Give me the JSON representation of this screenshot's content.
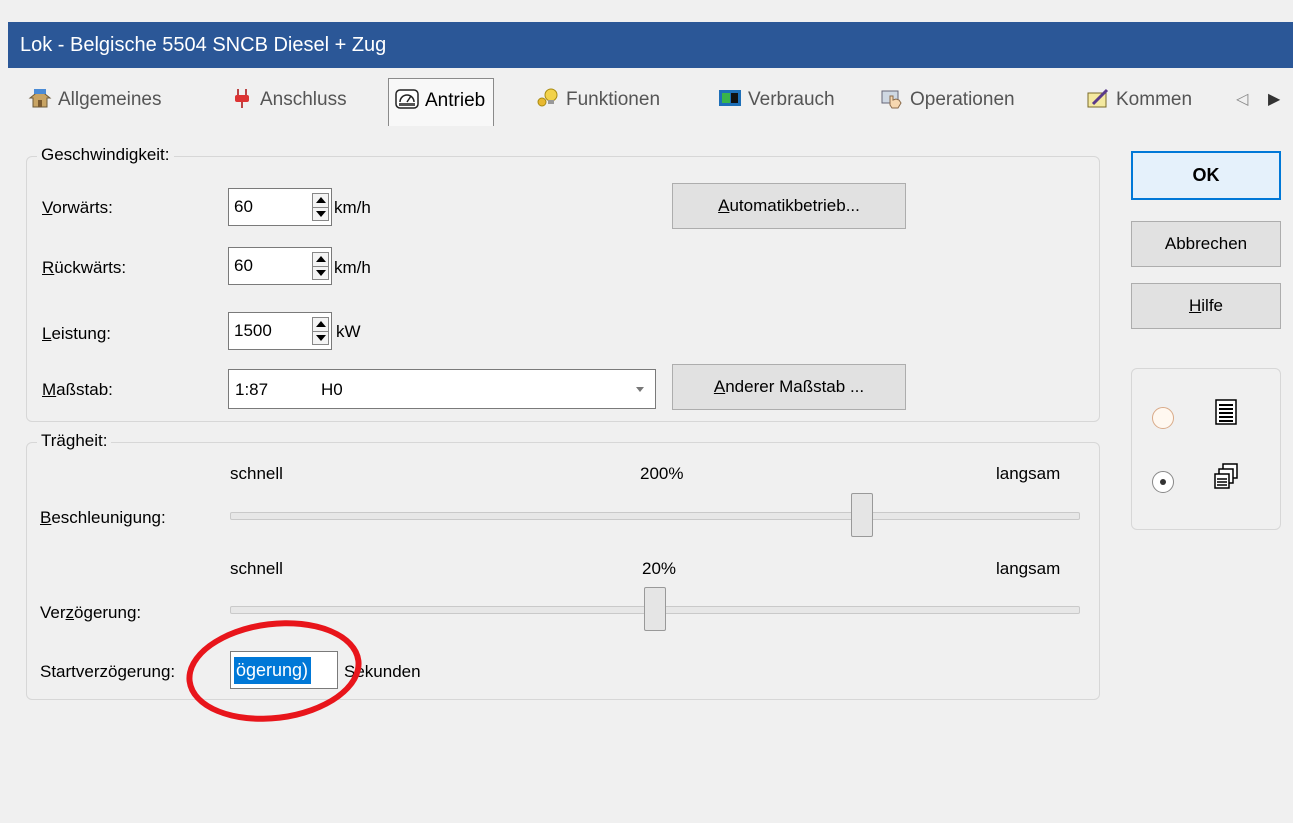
{
  "window": {
    "title": "Lok - Belgische 5504 SNCB Diesel + Zug"
  },
  "tabs": [
    {
      "label": "Allgemeines",
      "icon": "house-icon"
    },
    {
      "label": "Anschluss",
      "icon": "plug-icon"
    },
    {
      "label": "Antrieb",
      "icon": "gauge-icon",
      "active": true
    },
    {
      "label": "Funktionen",
      "icon": "light-bulb-icon"
    },
    {
      "label": "Verbrauch",
      "icon": "fuel-icon"
    },
    {
      "label": "Operationen",
      "icon": "hand-icon"
    },
    {
      "label": "Kommen",
      "icon": "notepad-pencil-icon"
    }
  ],
  "tab_scroll": {
    "left": "◁",
    "right": "▶"
  },
  "geschwindigkeit": {
    "title": "Geschwindigkeit:",
    "vorwaerts": {
      "label_key": "V",
      "label_rest": "orwärts:",
      "value": "60",
      "unit": "km/h"
    },
    "rueckwaerts": {
      "label_key": "R",
      "label_rest": "ückwärts:",
      "value": "60",
      "unit": "km/h"
    },
    "leistung": {
      "label_key": "L",
      "label_rest": "eistung:",
      "value": "1500",
      "unit": "kW"
    },
    "massstab": {
      "label_key": "M",
      "label_rest": "aßstab:",
      "scale": "1:87",
      "gauge": "H0"
    },
    "automatik_button": {
      "key": "A",
      "rest": "utomatikbetrieb..."
    },
    "anderer_button": {
      "key": "A",
      "rest": "nderer Maßstab ..."
    }
  },
  "traegheit": {
    "title": "Trägheit:",
    "beschleunigung": {
      "label_key": "B",
      "label_rest": "eschleunigung:",
      "left": "schnell",
      "right": "langsam",
      "value_text": "200%",
      "position": 0.75
    },
    "verzoegerung": {
      "label_pre": "Ver",
      "label_key": "z",
      "label_rest": "ögerung:",
      "left": "schnell",
      "right": "langsam",
      "value_text": "20%",
      "position": 0.5
    },
    "startverzoegerung": {
      "label": "Startverzögerung:",
      "value": "ögerung)",
      "unit": "Sekunden"
    }
  },
  "buttons": {
    "ok": "OK",
    "cancel": "Abbrechen",
    "help_key": "H",
    "help_rest": "ilfe"
  },
  "view_options": [
    {
      "icon": "list-view-icon",
      "checked": false
    },
    {
      "icon": "multi-window-icon",
      "checked": true
    }
  ],
  "colors": {
    "titlebar": "#2b5797",
    "selection": "#0078d7",
    "annotation": "#e8151b",
    "primary_border": "#0078d7"
  }
}
